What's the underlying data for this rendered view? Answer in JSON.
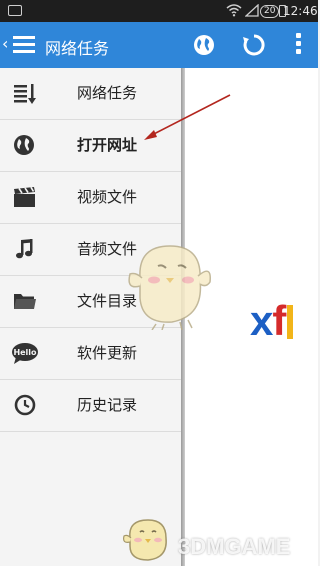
{
  "status_bar": {
    "time": "12:46",
    "badge": "20"
  },
  "toolbar": {
    "title": "网络任务"
  },
  "drawer": {
    "items": [
      {
        "label": "网络任务",
        "icon": "list-sort-icon"
      },
      {
        "label": "打开网址",
        "icon": "globe-icon",
        "active": true
      },
      {
        "label": "视频文件",
        "icon": "clapperboard-icon"
      },
      {
        "label": "音频文件",
        "icon": "music-note-icon"
      },
      {
        "label": "文件目录",
        "icon": "folder-icon"
      },
      {
        "label": "软件更新",
        "icon": "hello-bubble-icon",
        "badge_text": "Hello"
      },
      {
        "label": "历史记录",
        "icon": "clock-icon"
      }
    ]
  },
  "content": {
    "logo_prefix": "x",
    "logo_f": "f"
  },
  "watermark": "3DMGAME",
  "colors": {
    "toolbar": "#2f86d9",
    "arrow": "#b3261e",
    "logo_blue": "#1c5fc4",
    "logo_red": "#d52b2b"
  }
}
